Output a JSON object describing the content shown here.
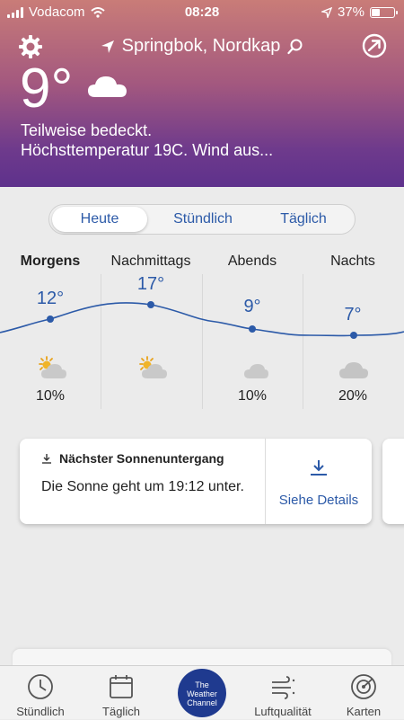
{
  "status": {
    "carrier": "Vodacom",
    "time": "08:28",
    "battery": "37%",
    "battery_level": 0.37
  },
  "header": {
    "location": "Springbok, Nordkap",
    "current_temp": "9°",
    "description_line1": "Teilweise bedeckt.",
    "description_line2": "Höchsttemperatur 19C. Wind aus..."
  },
  "tabs": [
    {
      "label": "Heute",
      "active": true
    },
    {
      "label": "Stündlich",
      "active": false
    },
    {
      "label": "Täglich",
      "active": false
    }
  ],
  "forecast": [
    {
      "period": "Morgens",
      "temp": "12°",
      "icon": "partly-sunny-icon",
      "precip": "10%"
    },
    {
      "period": "Nachmittags",
      "temp": "17°",
      "icon": "partly-sunny-icon",
      "precip": ""
    },
    {
      "period": "Abends",
      "temp": "9°",
      "icon": "partly-cloudy-night-icon",
      "precip": "10%"
    },
    {
      "period": "Nachts",
      "temp": "7°",
      "icon": "cloud-icon",
      "precip": "20%"
    }
  ],
  "sunset_card": {
    "title": "Nächster Sonnenuntergang",
    "text": "Die Sonne geht um 19:12 unter.",
    "link": "Siehe Details"
  },
  "bottom_nav": [
    {
      "label": "Stündlich",
      "icon": "clock-icon"
    },
    {
      "label": "Täglich",
      "icon": "calendar-icon"
    },
    {
      "label": "",
      "icon": "the-weather-channel-logo"
    },
    {
      "label": "Luftqualität",
      "icon": "wind-icon"
    },
    {
      "label": "Karten",
      "icon": "radar-icon"
    }
  ],
  "logo_text": "The Weather Channel",
  "colors": {
    "accent": "#2c5aa8",
    "header_top": "#c97c78",
    "header_bottom": "#5e318c",
    "logo_bg": "#1f3a8f"
  }
}
